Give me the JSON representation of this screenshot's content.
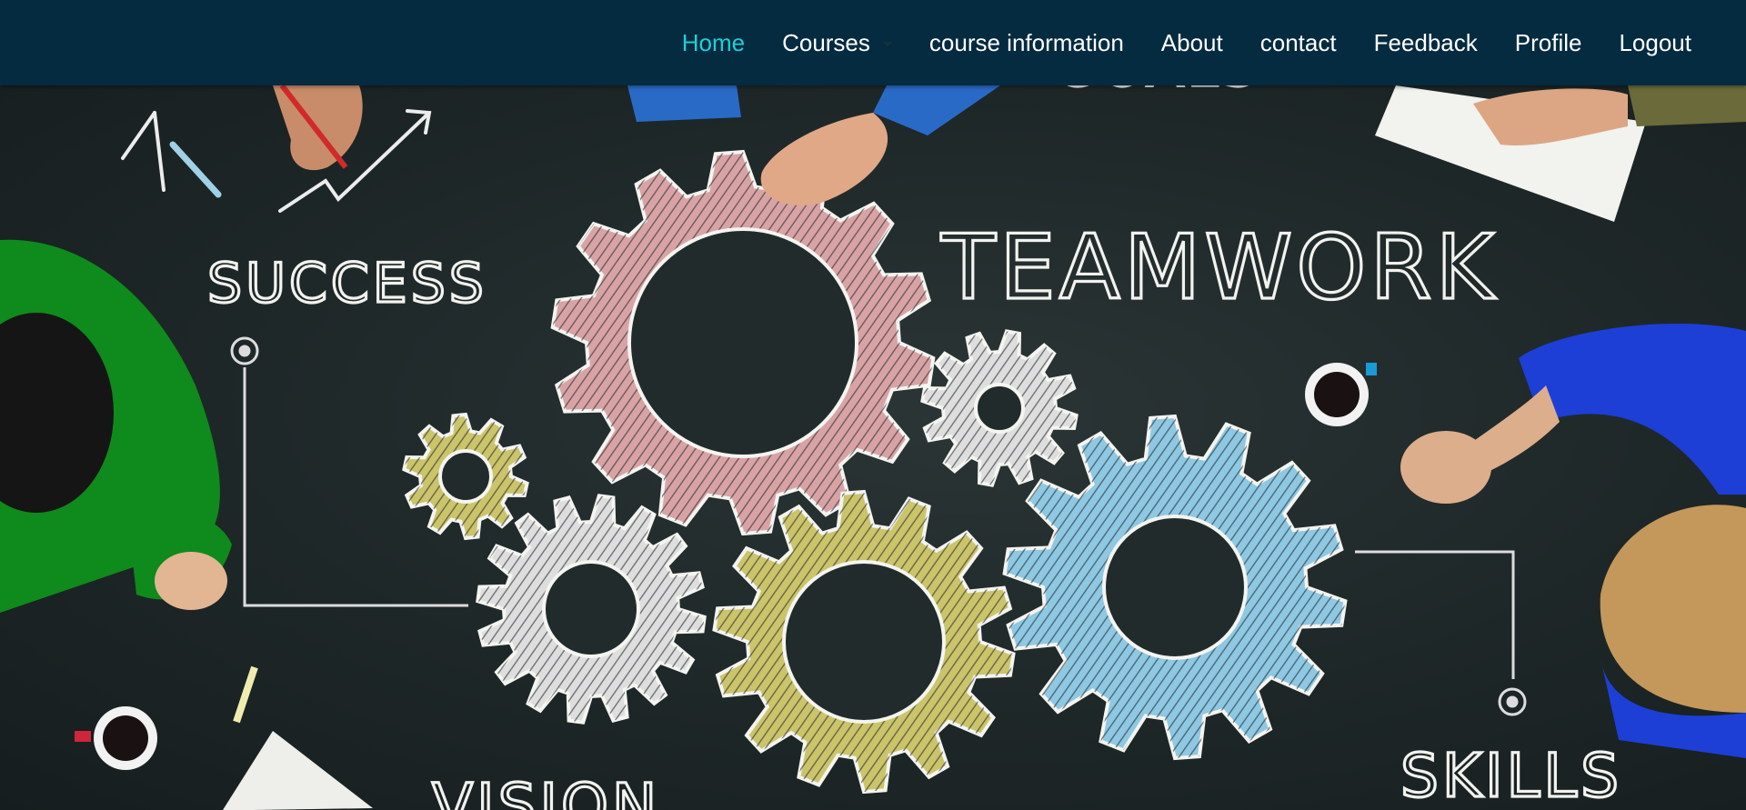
{
  "nav": {
    "items": [
      {
        "label": "Home",
        "active": true
      },
      {
        "label": "Courses",
        "has_dropdown": true
      },
      {
        "label": "course information"
      },
      {
        "label": "About"
      },
      {
        "label": "contact"
      },
      {
        "label": "Feedback"
      },
      {
        "label": "Profile"
      },
      {
        "label": "Logout"
      }
    ],
    "colors": {
      "background": "#042b40",
      "active": "#1ed0d6",
      "text": "#ffffff"
    }
  },
  "hero": {
    "chalk_words": {
      "teamwork": "TEAMWORK",
      "success": "SUCCESS",
      "skills": "SKILLS",
      "vision": "VISION",
      "goals": "GOALS"
    },
    "gear_colors": {
      "pink": "#d9a3a6",
      "white": "#dedede",
      "yellow": "#cbc46a",
      "blue": "#8ec8e3"
    }
  }
}
